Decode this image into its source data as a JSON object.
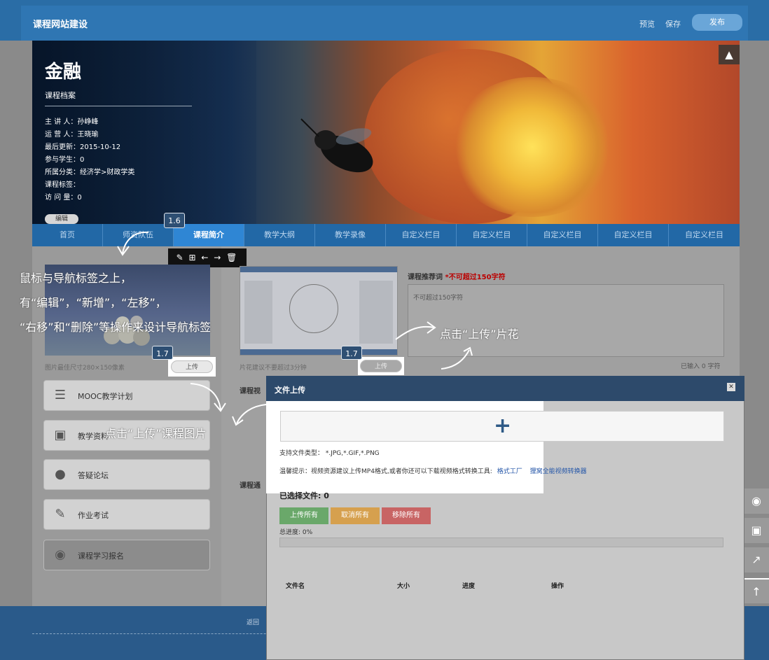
{
  "topbar": {
    "title": "课程网站建设",
    "preview": "预览",
    "save": "保存",
    "publish": "发布"
  },
  "hero": {
    "course_title": "金融",
    "profile_label": "课程档案",
    "meta": [
      "主 讲 人：孙峥峰",
      "运 营 人：王晓瑜",
      "最后更新：2015-10-12",
      "参与学生：0",
      "所属分类：经济学>财政学类",
      "课程标签：",
      "访 问 量：0"
    ],
    "edit": "编辑",
    "shirt_icon": "shirt-icon"
  },
  "nav": {
    "items": [
      "首页",
      "师资队伍",
      "课程简介",
      "教学大纲",
      "教学录像",
      "自定义栏目",
      "自定义栏目",
      "自定义栏目",
      "自定义栏目",
      "自定义栏目"
    ],
    "active_index": 2
  },
  "badges": {
    "b16": "1.6",
    "b17a": "1.7",
    "b17b": "1.7"
  },
  "toolbar_icons": [
    "edit-icon",
    "add-icon",
    "left-icon",
    "right-icon",
    "delete-icon"
  ],
  "toolbar_glyphs": "✎ ⊞ ← → 🗑",
  "content": {
    "pic_note": "图片最佳尺寸280×150像素",
    "upload": "上传",
    "video_note": "片花建议不要超过3分钟",
    "promo_label": "课程推荐词",
    "promo_required": "*不可超过150字符",
    "promo_placeholder": "不可超过150字符",
    "typed_count": "已输入 0 字符",
    "section_video": "课程视",
    "section_notice": "课程通"
  },
  "sidebar": {
    "items": [
      {
        "label": "MOOC教学计划",
        "icon": "list-icon"
      },
      {
        "label": "教学资料",
        "icon": "folder-icon"
      },
      {
        "label": "答疑论坛",
        "icon": "chat-icon"
      },
      {
        "label": "作业考试",
        "icon": "pencil-icon"
      },
      {
        "label": "课程学习报名",
        "icon": "location-icon"
      }
    ]
  },
  "annotations": {
    "nav_line1": "鼠标与导航标签之上，",
    "nav_line2": "有“编辑”，“新增”，“左移”，",
    "nav_line3": "“右移”和“删除”等操作来设计导航标签",
    "upload_video": "点击“上传”片花",
    "upload_pic": "点击“上传”课程图片"
  },
  "footer": {
    "link": "返回"
  },
  "right_tools": [
    "eye-icon",
    "save-icon",
    "share-icon",
    "top-icon"
  ],
  "dialog": {
    "title": "文件上传",
    "plus": "+",
    "support_types": "支持文件类型： *.JPG,*.GIF,*.PNG",
    "tip_prefix": "温馨提示：视频资源建议上传MP4格式,或者你还可以下载视频格式转换工具:",
    "tool1": "格式工厂",
    "tool2": "狸窝全能视频转换器",
    "selected": "已选择文件: 0",
    "btn_upload_all": "上传所有",
    "btn_cancel_all": "取消所有",
    "btn_remove_all": "移除所有",
    "progress": "总进度: 0%",
    "col_name": "文件名",
    "col_size": "大小",
    "col_progress": "进度",
    "col_action": "操作",
    "colors": {
      "upload": "#6aa86a",
      "cancel": "#d6a04e",
      "remove": "#c86464"
    }
  }
}
